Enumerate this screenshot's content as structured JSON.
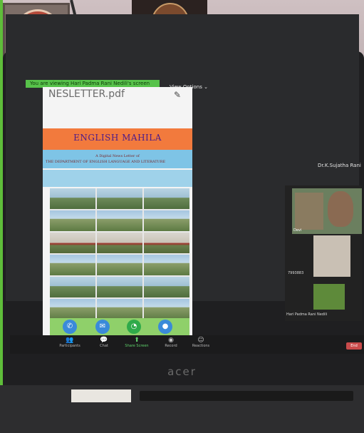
{
  "share_banner": "You are viewing Hari Padma Rani Nedili's screen",
  "view_options": "View Options ⌄",
  "document": {
    "filename": "NESLETTER.pdf",
    "heading": "ENGLISH MAHILA",
    "subtitle_1": "A Digital News Letter of",
    "subtitle_2": "THE DEPARTMENT OF ENGLISH LANGUAGE AND LITERATURE"
  },
  "participants": {
    "top_name": "Dr.K.Sujatha Rani",
    "tile1_label": "Devi",
    "tile2_label": "7993883",
    "tile3_label": "Hari Padma Rani Nedili"
  },
  "toolbar": {
    "participants": "Participants",
    "chat": "Chat",
    "share_screen": "Share Screen",
    "record": "Record",
    "reactions": "Reactions",
    "end": "End"
  },
  "brand": "acer"
}
